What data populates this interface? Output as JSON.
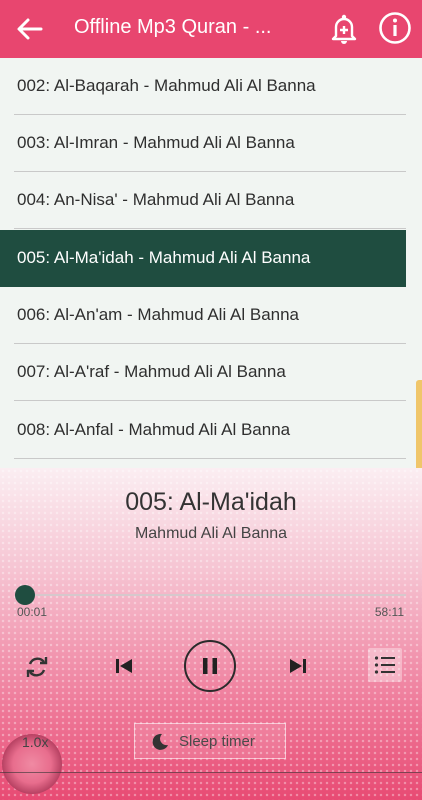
{
  "appbar": {
    "title": "Offline Mp3 Quran - ...",
    "icons": [
      "back-arrow-icon",
      "alarm-add-icon",
      "info-icon"
    ]
  },
  "playlist": [
    {
      "label": "002: Al-Baqarah - Mahmud Ali Al Banna",
      "active": false
    },
    {
      "label": "003: Al-Imran - Mahmud Ali Al Banna",
      "active": false
    },
    {
      "label": "004: An-Nisa' - Mahmud Ali Al Banna",
      "active": false
    },
    {
      "label": "005: Al-Ma'idah - Mahmud Ali Al Banna",
      "active": true
    },
    {
      "label": "006: Al-An'am - Mahmud Ali Al Banna",
      "active": false
    },
    {
      "label": "007: Al-A'raf - Mahmud Ali Al Banna",
      "active": false
    },
    {
      "label": "008: Al-Anfal - Mahmud Ali Al Banna",
      "active": false
    }
  ],
  "player": {
    "song_title": "005: Al-Ma'idah",
    "artist": "Mahmud Ali Al Banna",
    "current_time": "00:01",
    "duration": "58:11",
    "progress_fraction": 0.0003,
    "speed": "1.0x",
    "sleep_timer_label": "Sleep timer",
    "controls": [
      "repeat-icon",
      "previous-icon",
      "pause-icon",
      "next-icon",
      "playlist-icon"
    ]
  },
  "colors": {
    "accent": "#e8466f",
    "active_row": "#1f4d40",
    "list_background": "#f1f5f2"
  }
}
